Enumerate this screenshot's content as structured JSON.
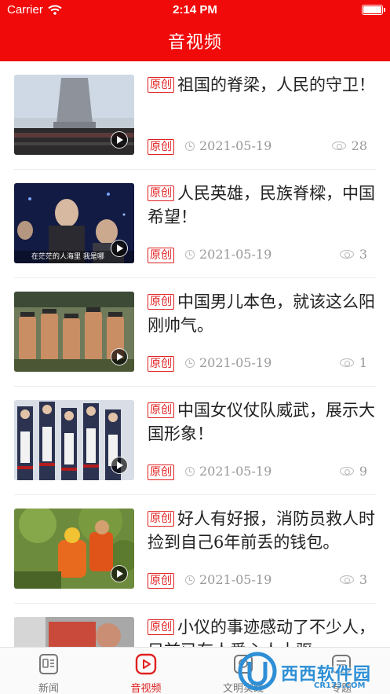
{
  "status_bar": {
    "carrier": "Carrier",
    "time": "2:14 PM"
  },
  "header": {
    "title": "音视频"
  },
  "articles": [
    {
      "title": "祖国的脊梁，人民的守卫！",
      "tag": "原创",
      "date": "2021-05-19",
      "views": "28",
      "thumb_caption": ""
    },
    {
      "title": "人民英雄，民族脊樑，中国希望！",
      "tag": "原创",
      "date": "2021-05-19",
      "views": "3",
      "thumb_caption": "在茫茫的人海里 我是哪"
    },
    {
      "title": "中国男儿本色，就该这么阳刚帅气。",
      "tag": "原创",
      "date": "2021-05-19",
      "views": "1",
      "thumb_caption": ""
    },
    {
      "title": "中国女仪仗队威武，展示大国形象！",
      "tag": "原创",
      "date": "2021-05-19",
      "views": "9",
      "thumb_caption": ""
    },
    {
      "title": "好人有好报，消防员救人时捡到自己6年前丢的钱包。",
      "tag": "原创",
      "date": "2021-05-19",
      "views": "3",
      "thumb_caption": ""
    },
    {
      "title": "小仪的事迹感动了不少人，目前已有人爱心人士驱",
      "tag": "原创",
      "date": "",
      "views": "",
      "thumb_caption": ""
    }
  ],
  "tabbar": {
    "tabs": [
      {
        "label": "新闻",
        "icon": "news-icon"
      },
      {
        "label": "音视频",
        "icon": "video-icon",
        "active": true
      },
      {
        "label": "文明实践",
        "icon": "practice-icon"
      },
      {
        "label": "专题",
        "icon": "topic-icon"
      }
    ]
  },
  "watermark": {
    "text": "西西软件园",
    "sub": "CR173.COM"
  },
  "colors": {
    "brand_red": "#f00a0a",
    "tag_red": "#e02020",
    "meta_gray": "#999999",
    "watermark_blue": "#2e8fd6"
  }
}
